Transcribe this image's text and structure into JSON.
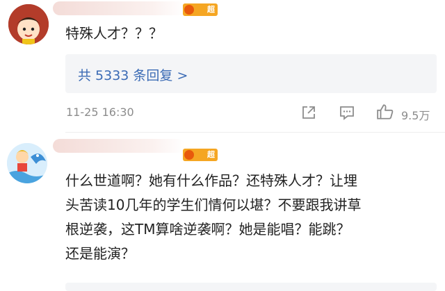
{
  "comments": [
    {
      "text": "特殊人才？？？",
      "reply_summary": "共 5333 条回复 >",
      "timestamp": "11-25 16:30",
      "like_count": "9.5万",
      "badge_label": "超"
    },
    {
      "text_lines": [
        "什么世道啊？她有什么作品？还特殊人才？让埋",
        "头苦读10几年的学生们情何以堪？不要跟我讲草",
        "根逆袭，这TM算啥逆袭啊？她是能唱？能跳？",
        "还是能演？"
      ],
      "badge_label": "超"
    }
  ],
  "colors": {
    "link": "#3b6bb5",
    "meta": "#8c8c8c",
    "badge": "#f5a623",
    "reply_bg": "#f4f5f7"
  },
  "icons": [
    "share-icon",
    "comment-icon",
    "like-icon"
  ]
}
